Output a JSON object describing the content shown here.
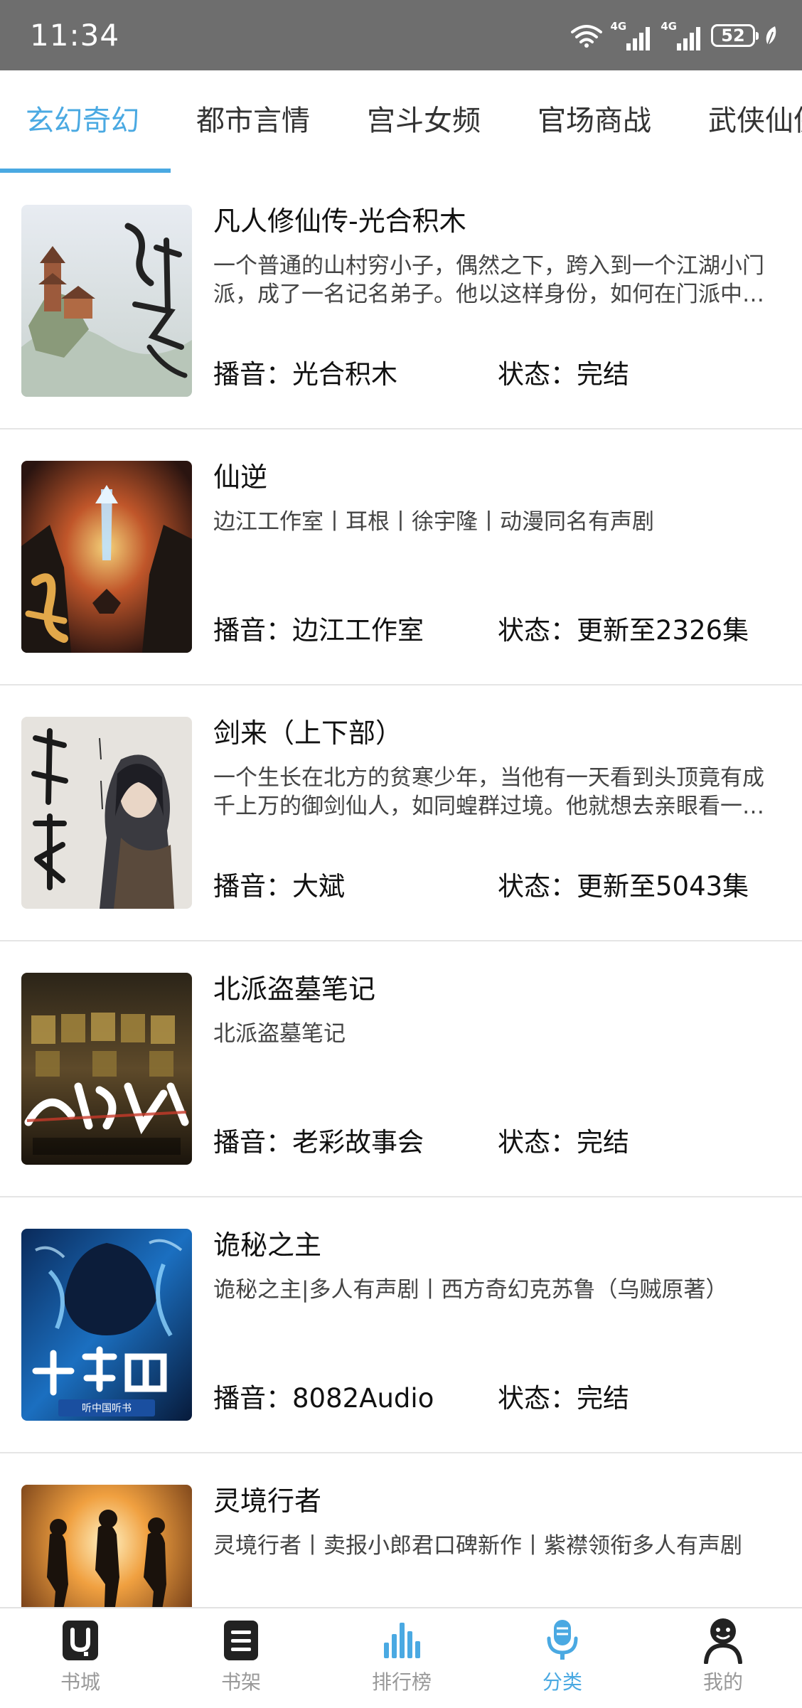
{
  "status_bar": {
    "time": "11:34",
    "network_1": "4G",
    "network_2": "4G",
    "battery": "52"
  },
  "category_tabs": [
    {
      "label": "玄幻奇幻",
      "active": true
    },
    {
      "label": "都市言情",
      "active": false
    },
    {
      "label": "宫斗女频",
      "active": false
    },
    {
      "label": "官场商战",
      "active": false
    },
    {
      "label": "武侠仙侠",
      "active": false
    }
  ],
  "books": [
    {
      "title": "凡人修仙传-光合积木",
      "description": "一个普通的山村穷小子，偶然之下，跨入到一个江湖小门派，成了一名记名弟子。他以这样身份，如何在门派中立足，如何以平庸的资质进入到修仙者的行列……",
      "narrator_label": "播音：光合积木",
      "status_label": "状态：完结",
      "cover_text": "凡人修仙传"
    },
    {
      "title": "仙逆",
      "description": "边江工作室丨耳根丨徐宇隆丨动漫同名有声剧",
      "narrator_label": "播音：边江工作室",
      "status_label": "状态：更新至2326集",
      "cover_text": "仙逆"
    },
    {
      "title": "剑来（上下部）",
      "description": "一个生长在北方的贫寒少年，当他有一天看到头顶竟有成千上万的御剑仙人，如同蝗群过境。他就想去亲眼看一看……",
      "narrator_label": "播音：大斌",
      "status_label": "状态：更新至5043集",
      "cover_text": "剑来"
    },
    {
      "title": "北派盗墓笔记",
      "description": "北派盗墓笔记",
      "narrator_label": "播音：老彩故事会",
      "status_label": "状态：完结",
      "cover_text": "北派盗墓"
    },
    {
      "title": "诡秘之主",
      "description": "诡秘之主|多人有声剧丨西方奇幻克苏鲁（乌贼原著）",
      "narrator_label": "播音：8082Audio",
      "status_label": "状态：完结",
      "cover_text": "暂無时面",
      "cover_badge": "听中国听书"
    },
    {
      "title": "灵境行者",
      "description": "灵境行者丨卖报小郎君口碑新作丨紫襟领衔多人有声剧",
      "narrator_label": "",
      "status_label": "",
      "cover_text": ""
    }
  ],
  "bottom_nav": [
    {
      "label": "书城",
      "icon": "store-icon",
      "active": false
    },
    {
      "label": "书架",
      "icon": "bookshelf-icon",
      "active": false
    },
    {
      "label": "排行榜",
      "icon": "ranking-icon",
      "active": false
    },
    {
      "label": "分类",
      "icon": "microphone-icon",
      "active": true
    },
    {
      "label": "我的",
      "icon": "profile-icon",
      "active": false
    }
  ],
  "colors": {
    "accent": "#4aa9e2",
    "status_bar": "#6e6e6e",
    "divider": "#e5e5e5",
    "inactive_nav": "#999999"
  }
}
